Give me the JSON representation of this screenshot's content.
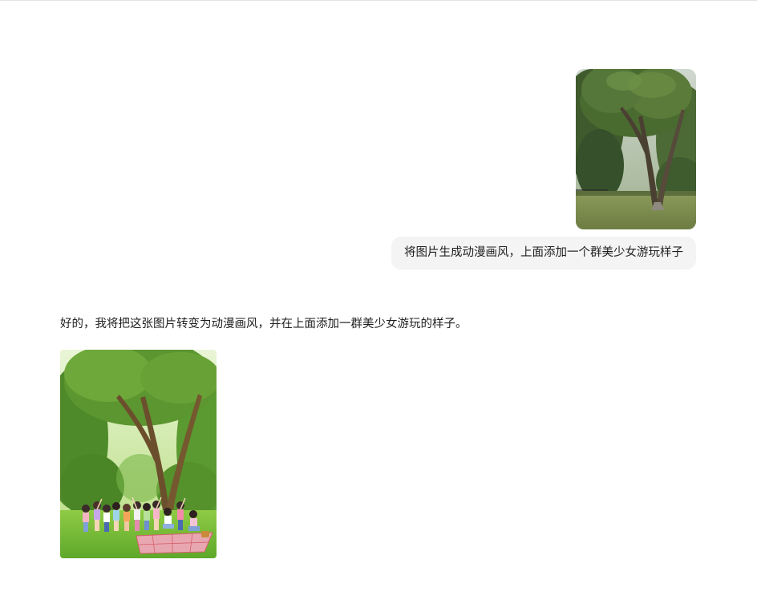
{
  "conversation": {
    "user_message": {
      "image_icon": "park-tree-photo",
      "text": "将图片生成动漫画风，上面添加一个群美少女游玩样子"
    },
    "assistant_message": {
      "text": "好的，我将把这张图片转变为动漫画风，并在上面添加一群美少女游玩的样子。",
      "image_icon": "anime-park-girls-illustration"
    }
  },
  "colors": {
    "bubble_bg": "#f4f4f4",
    "text": "#1f1f1f",
    "page_bg": "#ffffff"
  }
}
